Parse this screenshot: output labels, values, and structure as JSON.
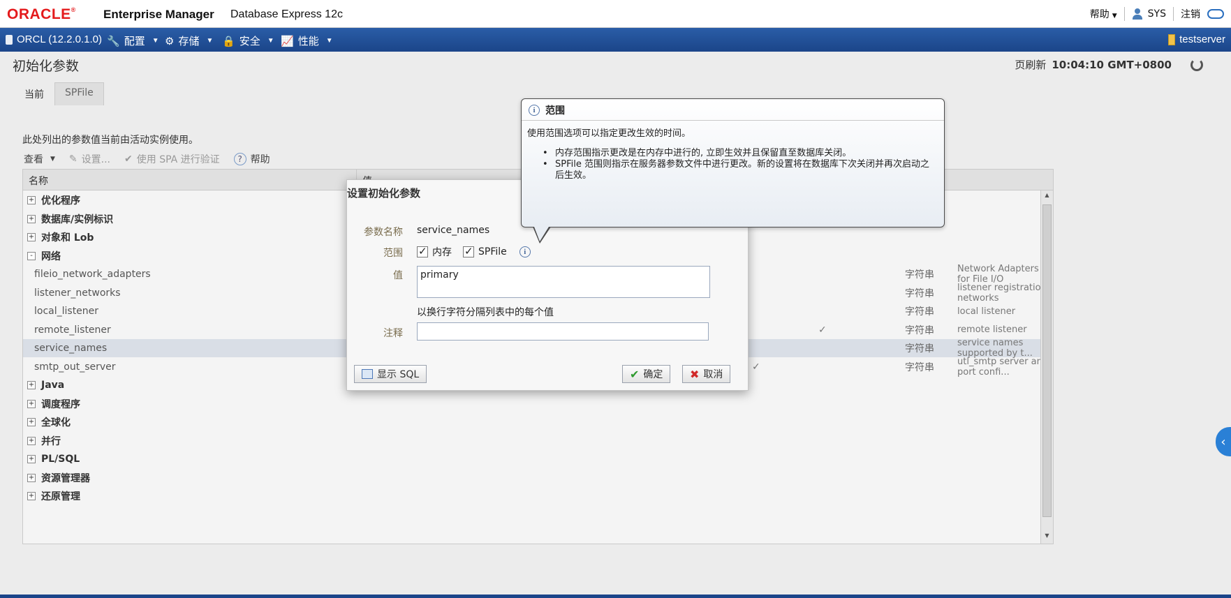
{
  "header": {
    "brand": "ORACLE",
    "product": "Enterprise Manager",
    "edition": "Database Express 12c",
    "help": "帮助",
    "user": "SYS",
    "logout": "注销"
  },
  "nav": {
    "db": "ORCL (12.2.0.1.0)",
    "items": [
      {
        "label": "配置",
        "icon": "wrench-icon"
      },
      {
        "label": "存储",
        "icon": "storage-icon"
      },
      {
        "label": "安全",
        "icon": "security-icon"
      },
      {
        "label": "性能",
        "icon": "performance-icon"
      }
    ],
    "server": "testserver"
  },
  "page": {
    "title": "初始化参数",
    "refresh_label": "页刷新",
    "refresh_time": "10:04:10 GMT+0800",
    "tabs": [
      "当前",
      "SPFile"
    ],
    "description": "此处列出的参数值当前由活动实例使用。"
  },
  "toolbar": {
    "view": "查看",
    "set": "设置...",
    "spa": "使用 SPA 进行验证",
    "help": "帮助"
  },
  "table": {
    "columns": [
      "名称",
      "值"
    ],
    "rows": [
      {
        "kind": "group",
        "expander": "+",
        "name": "优化程序"
      },
      {
        "kind": "group",
        "expander": "+",
        "name": "数据库/实例标识"
      },
      {
        "kind": "group",
        "expander": "+",
        "name": "对象和 Lob"
      },
      {
        "kind": "group",
        "expander": "-",
        "name": "网络"
      },
      {
        "kind": "leaf",
        "name": "fileio_network_adapters",
        "check": "",
        "type": "字符串",
        "desc": "Network Adapters for File I/O"
      },
      {
        "kind": "leaf",
        "name": "listener_networks",
        "check": "",
        "type": "字符串",
        "desc": "listener registration networks"
      },
      {
        "kind": "leaf",
        "name": "local_listener",
        "check": "",
        "type": "字符串",
        "desc": "local listener"
      },
      {
        "kind": "leaf",
        "name": "remote_listener",
        "check": "✓",
        "type": "字符串",
        "desc": "remote listener"
      },
      {
        "kind": "leaf",
        "name": "service_names",
        "check": "",
        "type": "字符串",
        "desc": "service names supported by t..."
      },
      {
        "kind": "leaf",
        "name": "smtp_out_server",
        "check": "✓",
        "type": "字符串",
        "desc": "utl_smtp server and port confi..."
      },
      {
        "kind": "group",
        "expander": "+",
        "name": "Java"
      },
      {
        "kind": "group",
        "expander": "+",
        "name": "调度程序"
      },
      {
        "kind": "group",
        "expander": "+",
        "name": "全球化"
      },
      {
        "kind": "group",
        "expander": "+",
        "name": "并行"
      },
      {
        "kind": "group",
        "expander": "+",
        "name": "PL/SQL"
      },
      {
        "kind": "group",
        "expander": "+",
        "name": "资源管理器"
      },
      {
        "kind": "group",
        "expander": "+",
        "name": "还原管理"
      }
    ]
  },
  "dialog": {
    "title": "设置初始化参数",
    "param_label": "参数名称",
    "param_value": "service_names",
    "scope_label": "范围",
    "scope_memory": "内存",
    "scope_spfile": "SPFile",
    "value_label": "值",
    "value": "primary",
    "value_hint": "以换行字符分隔列表中的每个值",
    "comment_label": "注释",
    "show_sql": "显示 SQL",
    "ok": "确定",
    "cancel": "取消"
  },
  "tooltip": {
    "title": "范围",
    "intro": "使用范围选项可以指定更改生效的时间。",
    "bullets": [
      "内存范围指示更改是在内存中进行的, 立即生效并且保留直至数据库关闭。",
      "SPFile 范围则指示在服务器参数文件中进行更改。新的设置将在数据库下次关闭并再次启动之后生效。"
    ]
  },
  "colors": {
    "brand_red": "#e41a1c",
    "nav_blue": "#1b4589"
  }
}
